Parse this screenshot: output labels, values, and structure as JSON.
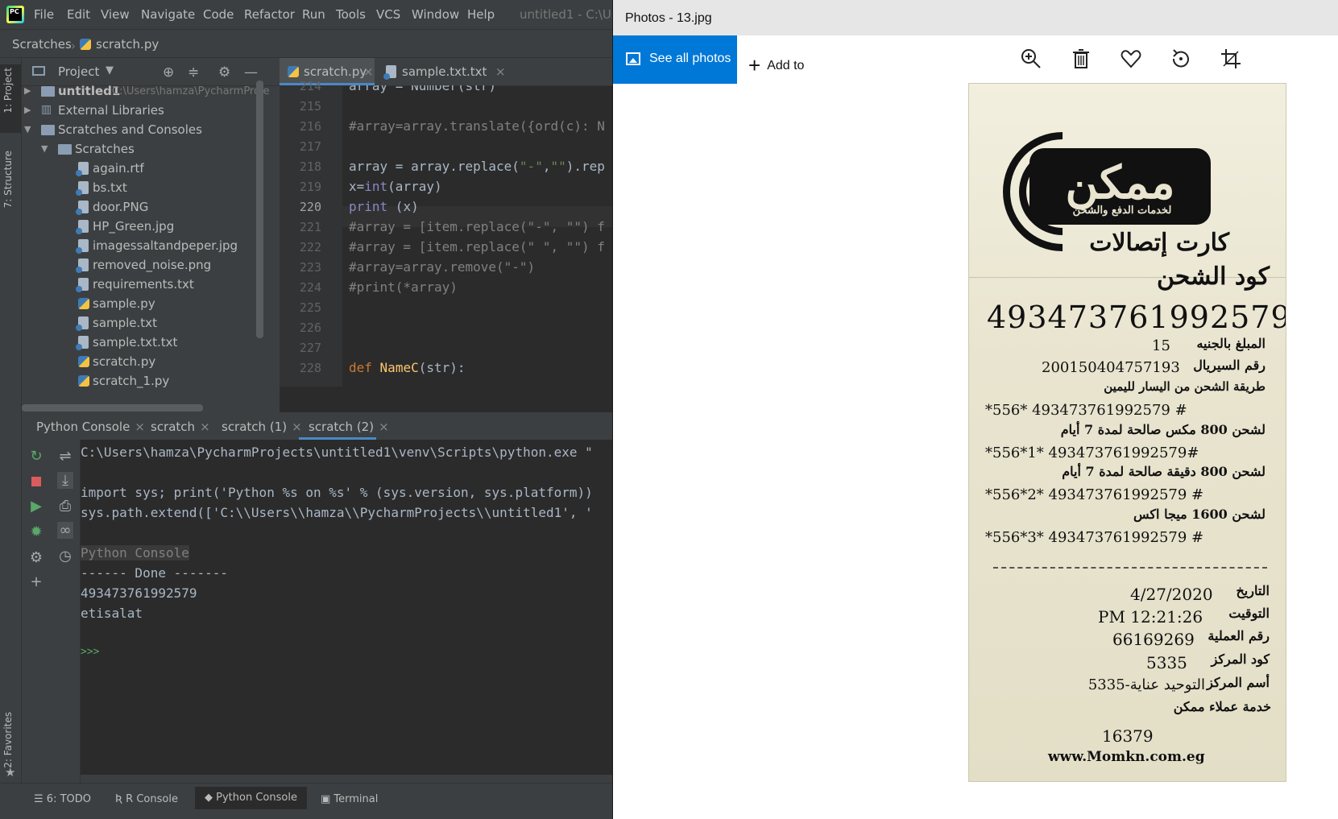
{
  "ide": {
    "menu": [
      "File",
      "Edit",
      "View",
      "Navigate",
      "Code",
      "Refactor",
      "Run",
      "Tools",
      "VCS",
      "Window",
      "Help"
    ],
    "window_title": "untitled1 - C:\\Use",
    "breadcrumb": {
      "root": "Scratches",
      "file": "scratch.py"
    },
    "left_stripe": {
      "project": "1: Project",
      "structure": "7: Structure",
      "favorites": "2: Favorites"
    },
    "project_panel": {
      "title": "Project",
      "tree": {
        "root_name": "untitled1",
        "root_path": "C:\\Users\\hamza\\PycharmProje",
        "external": "External Libraries",
        "scratches_consoles": "Scratches and Consoles",
        "scratches": "Scratches",
        "files": [
          "again.rtf",
          "bs.txt",
          "door.PNG",
          "HP_Green.jpg",
          "imagessaltandpeper.jpg",
          "removed_noise.png",
          "requirements.txt",
          "sample.py",
          "sample.txt",
          "sample.txt.txt",
          "scratch.py",
          "scratch_1.py"
        ]
      }
    },
    "editor": {
      "tabs": [
        {
          "label": "scratch.py",
          "active": true
        },
        {
          "label": "sample.txt.txt",
          "active": false
        }
      ],
      "current_line": "220",
      "line_numbers": [
        "214",
        "215",
        "216",
        "217",
        "218",
        "219",
        "220",
        "221",
        "222",
        "223",
        "224",
        "225",
        "226",
        "227",
        "228"
      ]
    },
    "run_panel": {
      "tabs": [
        "Python Console",
        "scratch",
        "scratch (1)",
        "scratch (2)"
      ],
      "active_tab": "scratch (2)",
      "lines": [
        "C:\\Users\\hamza\\PycharmProjects\\untitled1\\venv\\Scripts\\python.exe \"",
        "",
        "import sys; print('Python %s on %s' % (sys.version, sys.platform))",
        "sys.path.extend(['C:\\\\Users\\\\hamza\\\\PycharmProjects\\\\untitled1', '",
        "",
        "Python Console",
        "------ Done -------",
        "493473761992579",
        "etisalat",
        "",
        ">>>"
      ]
    },
    "status_bar": {
      "todo": "6: TODO",
      "r_console": "R Console",
      "python_console": "Python Console",
      "terminal": "Terminal"
    }
  },
  "photos": {
    "title": "Photos - 13.jpg",
    "see_all": "See all photos",
    "add_to": "Add to",
    "tools": [
      "zoom-in-icon",
      "delete-icon",
      "favorite-icon",
      "rotate-icon",
      "crop-icon"
    ],
    "receipt": {
      "brand": "ممكن",
      "brand_sub": "لخدمات الدفع والشحن",
      "card": "كارت إتصالات",
      "charge_code_label": "كود الشحن",
      "charge_code": "493473761992579",
      "amount_label": "المبلغ بالجنيه",
      "amount": "15",
      "serial_label": "رقم السيريال",
      "serial": "200150404757193",
      "method": "طريقة الشحن من اليسار لليمين",
      "codes": [
        {
          "code": "*556* 493473761992579 #",
          "desc": "لشحن 800 مكس صالحة لمدة 7 أيام"
        },
        {
          "code": "*556*1* 493473761992579#",
          "desc": "لشحن 800 دقيقة صالحة لمدة 7 أيام"
        },
        {
          "code": "*556*2* 493473761992579 #",
          "desc": "لشحن 1600 ميجا اكس"
        },
        {
          "code": "*556*3* 493473761992579 #",
          "desc": ""
        }
      ],
      "date_label": "التاريخ",
      "date": "4/27/2020",
      "time_label": "التوقيت",
      "time": "PM 12:21:26",
      "op_label": "رقم العملية",
      "op": "66169269",
      "center_code_label": "كود المركز",
      "center_code": "5335",
      "center_name_label": "أسم المركز",
      "center_name": "التوحيد عناية-5335",
      "service": "خدمة عملاء ممكن",
      "hotline": "16379",
      "website": "www.Momkn.com.eg"
    }
  }
}
